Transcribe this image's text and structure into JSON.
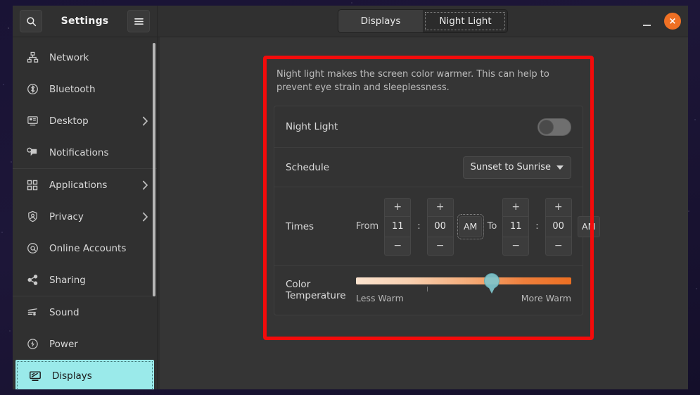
{
  "window": {
    "app_title": "Settings",
    "search_icon": "search-icon",
    "menu_icon": "hamburger-menu-icon",
    "minimize_label": "Minimize",
    "close_label": "×",
    "accent_close_color": "#ef7024"
  },
  "tabs": [
    {
      "label": "Displays",
      "active": false
    },
    {
      "label": "Night Light",
      "active": true
    }
  ],
  "sidebar": {
    "selected_highlight_color": "#9aeaea",
    "groups": [
      {
        "items": [
          {
            "label": "Network",
            "icon": "network-icon",
            "chevron": false
          },
          {
            "label": "Bluetooth",
            "icon": "bluetooth-icon",
            "chevron": false
          },
          {
            "label": "Desktop",
            "icon": "desktop-icon",
            "chevron": true
          },
          {
            "label": "Notifications",
            "icon": "notifications-icon",
            "chevron": false
          }
        ]
      },
      {
        "items": [
          {
            "label": "Applications",
            "icon": "applications-grid-icon",
            "chevron": true
          },
          {
            "label": "Privacy",
            "icon": "privacy-shield-icon",
            "chevron": true
          },
          {
            "label": "Online Accounts",
            "icon": "at-sign-icon",
            "chevron": false
          },
          {
            "label": "Sharing",
            "icon": "share-icon",
            "chevron": false
          }
        ]
      },
      {
        "items": [
          {
            "label": "Sound",
            "icon": "sound-icon",
            "chevron": false
          },
          {
            "label": "Power",
            "icon": "power-bolt-icon",
            "chevron": false
          },
          {
            "label": "Displays",
            "icon": "displays-icon",
            "chevron": false,
            "selected": true
          }
        ]
      }
    ]
  },
  "night_light": {
    "description": "Night light makes the screen color warmer. This can help to prevent eye strain and sleeplessness.",
    "toggle": {
      "label": "Night Light",
      "state": "off"
    },
    "schedule": {
      "label": "Schedule",
      "value": "Sunset to Sunrise",
      "caret_icon": "chevron-down-icon"
    },
    "times": {
      "label": "Times",
      "from_label": "From",
      "to_label": "To",
      "increment_label": "+",
      "decrement_label": "−",
      "colon": ":",
      "from": {
        "hour": "11",
        "minute": "00",
        "meridiem": "AM",
        "meridiem_focused": true
      },
      "to": {
        "hour": "11",
        "minute": "00",
        "meridiem": "AM",
        "meridiem_focused": false
      }
    },
    "color_temperature": {
      "label": "Color Temperature",
      "min_label": "Less Warm",
      "max_label": "More Warm",
      "value_percent": 63
    }
  },
  "annotation": {
    "highlight_color": "#f30b0b"
  }
}
